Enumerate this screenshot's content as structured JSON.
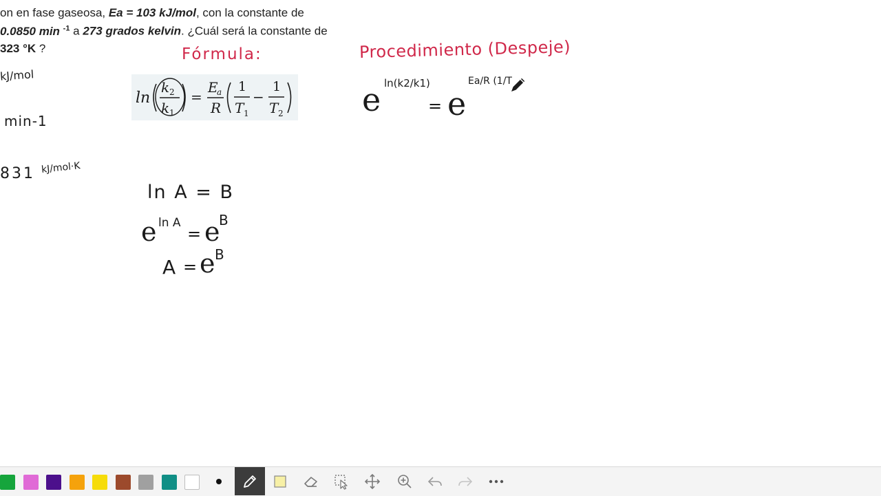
{
  "problem": {
    "line1_a": "on en fase gaseosa, ",
    "line1_b": "Ea = 103 kJ/mol",
    "line1_c": ",  con la constante de",
    "line2_a": "0.0850 min ",
    "line2_sup": "-1",
    "line2_b": " a ",
    "line2_c": "273 grados kelvin",
    "line2_d": ". ¿Cuál será la constante de",
    "line3_a": "323 °K",
    "line3_b": " ?"
  },
  "notes": {
    "left1": "kJ/mol",
    "left2": "min-1",
    "left3": "831",
    "left3_units": "kJ/mol·K",
    "formula_heading": "Fórmula:",
    "procedure_heading": "Procedimiento (Despeje)",
    "formula": {
      "ln": "ln",
      "k2": "k",
      "k2_sub": "2",
      "k1": "k",
      "k1_sub": "1",
      "eq": "=",
      "Ea": "E",
      "Ea_sub": "a",
      "R": "R",
      "one": "1",
      "T1": "T",
      "T1_sub": "1",
      "minus": "−",
      "T2": "T",
      "T2_sub": "2"
    },
    "proc": {
      "e_left": "e",
      "exp_left": "ln(k2/k1)",
      "eq": "=",
      "e_right": "e",
      "exp_right": "Ea/R (1/T"
    },
    "rule1": "ln A = B",
    "rule2_e": "e",
    "rule2_exp": "ln A",
    "rule2_eq": "=",
    "rule2_e2": "e",
    "rule2_exp2": "B",
    "rule3_A": "A",
    "rule3_eq": "=",
    "rule3_e": "e",
    "rule3_exp": "B"
  },
  "colors": {
    "ink_black": "#1b1b1b",
    "ink_red": "#d0284a",
    "toolbar_bg": "#f4f4f4",
    "active_tool": "#3c3c3c"
  },
  "toolbar": {
    "swatches": [
      "#16a53c",
      "#e06ad6",
      "#4c108c",
      "#f5a20c",
      "#f6dc0a",
      "#9c4a2c",
      "#a0a0a0",
      "#118f86",
      "#ffffff"
    ],
    "pen_size": "pen-size-dot-icon",
    "icons": [
      "pen-icon",
      "highlighter-icon",
      "eraser-icon",
      "lasso-select-icon",
      "move-icon",
      "zoom-icon",
      "undo-icon",
      "redo-icon",
      "more-icon"
    ]
  }
}
